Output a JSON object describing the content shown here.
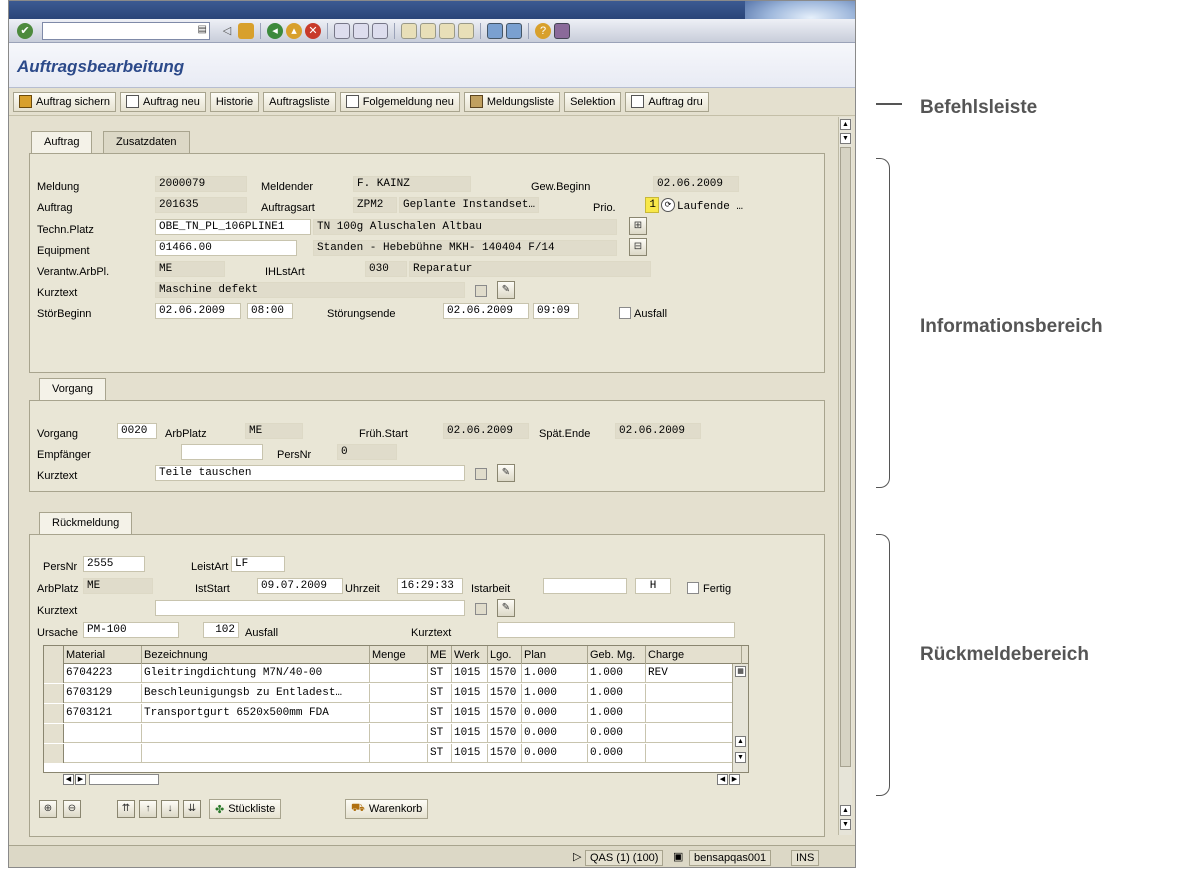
{
  "app": {
    "title": "Auftragsbearbeitung"
  },
  "appbar": {
    "save": "Auftrag sichern",
    "new": "Auftrag neu",
    "history": "Historie",
    "list": "Auftragsliste",
    "followup": "Folgemeldung neu",
    "notiflist": "Meldungsliste",
    "selection": "Selektion",
    "print": "Auftrag dru"
  },
  "tabs": {
    "order": "Auftrag",
    "extra": "Zusatzdaten",
    "operation": "Vorgang",
    "confirmation": "Rückmeldung"
  },
  "order": {
    "meldung_label": "Meldung",
    "meldung": "2000079",
    "melder_label": "Meldender",
    "melder": "F. KAINZ",
    "gewbeginn_label": "Gew.Beginn",
    "gewbeginn": "02.06.2009",
    "auftrag_label": "Auftrag",
    "auftrag": "201635",
    "art_label": "Auftragsart",
    "art_code": "ZPM2",
    "art_text": "Geplante Instandset…",
    "prio_label": "Prio.",
    "prio": "1",
    "prio_text": "Laufende …",
    "techplatz_label": "Techn.Platz",
    "techplatz": "OBE_TN_PL_106PLINE1",
    "techplatz_text": "TN 100g Aluschalen Altbau",
    "equipment_label": "Equipment",
    "equipment": "01466.00",
    "equipment_text": "Standen - Hebebühne MKH- 140404  F/14",
    "arbpl_label": "Verantw.ArbPl.",
    "arbpl": "ME",
    "ihlstart_label": "IHLstArt",
    "ihlstart": "030",
    "ihlstart_text": "Reparatur",
    "kurztext_label": "Kurztext",
    "kurztext": "Maschine defekt",
    "stoerbeginn_label": "StörBeginn",
    "stoerbeginn_date": "02.06.2009",
    "stoerbeginn_time": "08:00",
    "stoerende_label": "Störungsende",
    "stoerende_date": "02.06.2009",
    "stoerende_time": "09:09",
    "ausfall_label": "Ausfall"
  },
  "operation": {
    "vorgang_label": "Vorgang",
    "vorgang": "0020",
    "arbplatz_label": "ArbPlatz",
    "arbplatz": "ME",
    "fruehstart_label": "Früh.Start",
    "fruehstart": "02.06.2009",
    "spaetende_label": "Spät.Ende",
    "spaetende": "02.06.2009",
    "empfaenger_label": "Empfänger",
    "empfaenger": "",
    "persnr_label": "PersNr",
    "persnr": "0",
    "kurztext_label": "Kurztext",
    "kurztext": "Teile tauschen"
  },
  "confirmation": {
    "persnr_label": "PersNr",
    "persnr": "2555",
    "leistart_label": "LeistArt",
    "leistart": "LF",
    "arbplatz_label": "ArbPlatz",
    "arbplatz": "ME",
    "iststart_label": "IstStart",
    "iststart": "09.07.2009",
    "uhrzeit_label": "Uhrzeit",
    "uhrzeit": "16:29:33",
    "istarbeit_label": "Istarbeit",
    "istarbeit": "",
    "unit": "H",
    "fertig_label": "Fertig",
    "kurztext_label": "Kurztext",
    "kurztext": "",
    "ursache_label": "Ursache",
    "ursache_code": "PM-100",
    "ursache_num": "102",
    "ursache_text": "Ausfall",
    "ursache_kurztext_label": "Kurztext",
    "ursache_kurztext": ""
  },
  "table": {
    "headers": [
      "Material",
      "Bezeichnung",
      "Menge",
      "ME",
      "Werk",
      "Lgo.",
      "Plan",
      "Geb. Mg.",
      "Charge"
    ],
    "rows": [
      [
        "6704223",
        "Gleitringdichtung M7N/40-00",
        "",
        "ST",
        "1015",
        "1570",
        "1.000",
        "1.000",
        "REV"
      ],
      [
        "6703129",
        "Beschleunigungsb zu Entladest…",
        "",
        "ST",
        "1015",
        "1570",
        "1.000",
        "1.000",
        ""
      ],
      [
        "6703121",
        "Transportgurt 6520x500mm FDA",
        "",
        "ST",
        "1015",
        "1570",
        "0.000",
        "1.000",
        ""
      ],
      [
        "",
        "",
        "",
        "ST",
        "1015",
        "1570",
        "0.000",
        "0.000",
        ""
      ],
      [
        "",
        "",
        "",
        "ST",
        "1015",
        "1570",
        "0.000",
        "0.000",
        ""
      ]
    ]
  },
  "bottom": {
    "stueckliste": "Stückliste",
    "warenkorb": "Warenkorb"
  },
  "status": {
    "system": "QAS (1) (100)",
    "server": "bensapqas001",
    "mode": "INS"
  },
  "callouts": {
    "befehl": "Befehlsleiste",
    "info": "Informationsbereich",
    "rueck": "Rückmeldebereich"
  },
  "colors": {
    "title": "#2c4a8a",
    "background": "#e4e0cf",
    "prio": "#f8e84a"
  }
}
